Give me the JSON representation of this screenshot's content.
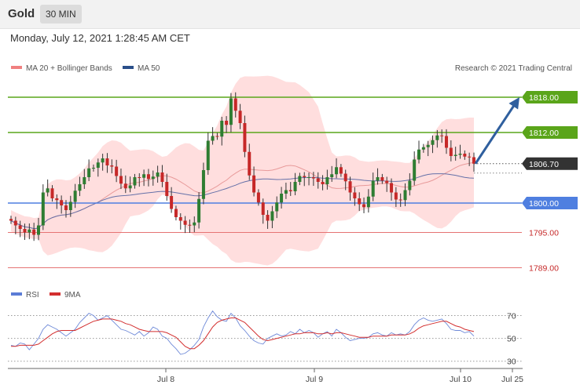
{
  "header": {
    "title": "Gold",
    "timeframe": "30 MIN",
    "datetime": "Monday, July 12, 2021 1:28:45 AM CET"
  },
  "legend": {
    "ma20_label": "MA 20 + Bollinger Bands",
    "ma20_color": "#f08080",
    "ma50_label": "MA 50",
    "ma50_color": "#2a4f8a",
    "credit": "Research © 2021 Trading Central"
  },
  "rsi_legend": {
    "rsi_label": "RSI",
    "rsi_color": "#5b7cd6",
    "ma9_label": "9MA",
    "ma9_color": "#d32f2f"
  },
  "colors": {
    "up_candle": "#2e7d32",
    "down_candle": "#c62828",
    "resistance": "#5aa51a",
    "support": "#4f7fe0",
    "pivot_red": "#e57373",
    "arrow": "#2f5f9e",
    "band_fill": "#ffdede"
  },
  "chart_data": [
    {
      "type": "candlestick",
      "instrument": "Gold",
      "timeframe": "30 MIN",
      "ylim": [
        1786,
        1822
      ],
      "x_ticks": [
        "Jul 8",
        "Jul 9",
        "Jul 10",
        "Jul 25"
      ],
      "current_price": 1806.7,
      "levels": [
        {
          "value": 1818.0,
          "label": "1818.00",
          "style": "resistance"
        },
        {
          "value": 1812.0,
          "label": "1812.00",
          "style": "resistance"
        },
        {
          "value": 1806.7,
          "label": "1806.70",
          "style": "current"
        },
        {
          "value": 1800.0,
          "label": "1800.00",
          "style": "support"
        },
        {
          "value": 1795.0,
          "label": "1795.00",
          "style": "pivot"
        },
        {
          "value": 1789.0,
          "label": "1789.00",
          "style": "pivot"
        }
      ],
      "forecast_arrow": {
        "from": 1806.7,
        "to": 1818.0,
        "direction": "up"
      },
      "closes": [
        1797.0,
        1796.2,
        1795.6,
        1795.0,
        1795.5,
        1794.6,
        1796.2,
        1801.8,
        1802.5,
        1800.8,
        1800.5,
        1799.6,
        1798.8,
        1800.2,
        1802.1,
        1803.2,
        1804.4,
        1805.9,
        1806.0,
        1806.9,
        1807.6,
        1806.4,
        1806.2,
        1804.6,
        1803.3,
        1802.5,
        1803.0,
        1804.4,
        1804.3,
        1804.9,
        1804.1,
        1804.5,
        1805.2,
        1803.6,
        1801.2,
        1799.0,
        1797.6,
        1797.0,
        1796.3,
        1796.2,
        1796.7,
        1800.7,
        1805.6,
        1810.6,
        1811.4,
        1811.3,
        1814.0,
        1813.3,
        1817.8,
        1815.7,
        1813.6,
        1808.7,
        1804.7,
        1801.8,
        1800.1,
        1798.0,
        1797.0,
        1798.6,
        1800.1,
        1801.6,
        1802.2,
        1802.0,
        1803.6,
        1804.6,
        1804.4,
        1804.4,
        1804.2,
        1803.6,
        1803.2,
        1804.4,
        1804.9,
        1806.1,
        1805.0,
        1803.7,
        1801.8,
        1800.8,
        1799.8,
        1799.3,
        1801.1,
        1803.8,
        1804.4,
        1803.8,
        1803.4,
        1801.8,
        1800.6,
        1800.5,
        1802.2,
        1803.8,
        1807.4,
        1809.1,
        1809.5,
        1809.9,
        1810.7,
        1811.5,
        1811.4,
        1809.4,
        1808.0,
        1808.2,
        1808.4,
        1807.9,
        1807.8,
        1806.7
      ],
      "rsi": {
        "ylim": [
          25,
          80
        ],
        "ticks": [
          30,
          50,
          70
        ],
        "values": [
          44,
          43,
          46,
          45,
          40,
          45,
          50,
          58,
          62,
          60,
          58,
          55,
          52,
          55,
          58,
          64,
          68,
          72,
          70,
          66,
          68,
          70,
          66,
          62,
          58,
          57,
          55,
          53,
          56,
          52,
          55,
          60,
          58,
          52,
          50,
          45,
          41,
          36,
          37,
          40,
          44,
          49,
          60,
          68,
          74,
          69,
          66,
          65,
          72,
          68,
          61,
          57,
          52,
          48,
          46,
          45,
          50,
          52,
          54,
          52,
          53,
          56,
          54,
          58,
          55,
          57,
          55,
          51,
          54,
          56,
          52,
          58,
          55,
          51,
          48,
          49,
          50,
          50,
          51,
          54,
          55,
          53,
          52,
          55,
          53,
          54,
          53,
          56,
          62,
          66,
          68,
          66,
          65,
          66,
          67,
          63,
          58,
          57,
          57,
          55,
          56,
          52
        ],
        "ma9": [
          43,
          43,
          44,
          44,
          44,
          44,
          45,
          48,
          51,
          54,
          56,
          57,
          57,
          57,
          57,
          59,
          61,
          63,
          65,
          66,
          67,
          67,
          67,
          66,
          65,
          63,
          62,
          60,
          58,
          57,
          56,
          56,
          56,
          56,
          55,
          53,
          51,
          47,
          43,
          41,
          41,
          44,
          48,
          54,
          60,
          64,
          66,
          67,
          68,
          68,
          66,
          64,
          60,
          56,
          52,
          49,
          48,
          49,
          50,
          51,
          52,
          53,
          54,
          54,
          55,
          55,
          55,
          54,
          54,
          55,
          54,
          55,
          55,
          54,
          53,
          52,
          51,
          51,
          51,
          52,
          52,
          52,
          52,
          53,
          53,
          53,
          53,
          54,
          56,
          59,
          61,
          62,
          63,
          64,
          65,
          65,
          63,
          61,
          60,
          58,
          57,
          56
        ]
      }
    }
  ]
}
